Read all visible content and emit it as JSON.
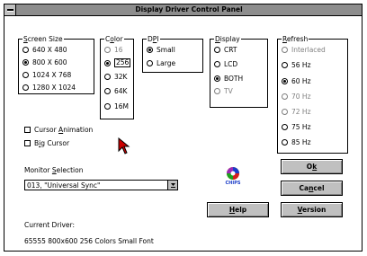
{
  "window": {
    "title": "Display Driver Control Panel"
  },
  "screen_size": {
    "label": "Screen Size",
    "options": [
      "640 X 480",
      "800 X 600",
      "1024 X 768",
      "1280 X 1024"
    ],
    "selected": 1
  },
  "color": {
    "label": "Color",
    "options": [
      "16",
      "256",
      "32K",
      "64K",
      "16M"
    ],
    "selected": 1
  },
  "dpi": {
    "label": "DPI",
    "options": [
      "Small",
      "Large"
    ],
    "selected": 0
  },
  "display": {
    "label": "Display",
    "options": [
      "CRT",
      "LCD",
      "BOTH",
      "TV"
    ],
    "selected": 2
  },
  "refresh": {
    "label": "Refresh",
    "options": [
      "Interlaced",
      "56 Hz",
      "60 Hz",
      "70 Hz",
      "72 Hz",
      "75 Hz",
      "85 Hz"
    ],
    "selected": 2
  },
  "checkboxes": {
    "cursor_animation": "Cursor Animation",
    "big_cursor": "Big Cursor"
  },
  "monitor": {
    "label": "Monitor Selection",
    "value": "013, \"Universal Sync\""
  },
  "logo": {
    "text": "CHIPS"
  },
  "buttons": {
    "ok": "Ok",
    "cancel": "Cancel",
    "help": "Help",
    "version": "Version"
  },
  "current_driver": {
    "label": "Current Driver:",
    "value": "65555 800x600 256 Colors Small Font"
  },
  "colors": {
    "titlebar": "#8d8d8d",
    "button_face": "#c0c0c0",
    "cursor": "#cc0000"
  }
}
